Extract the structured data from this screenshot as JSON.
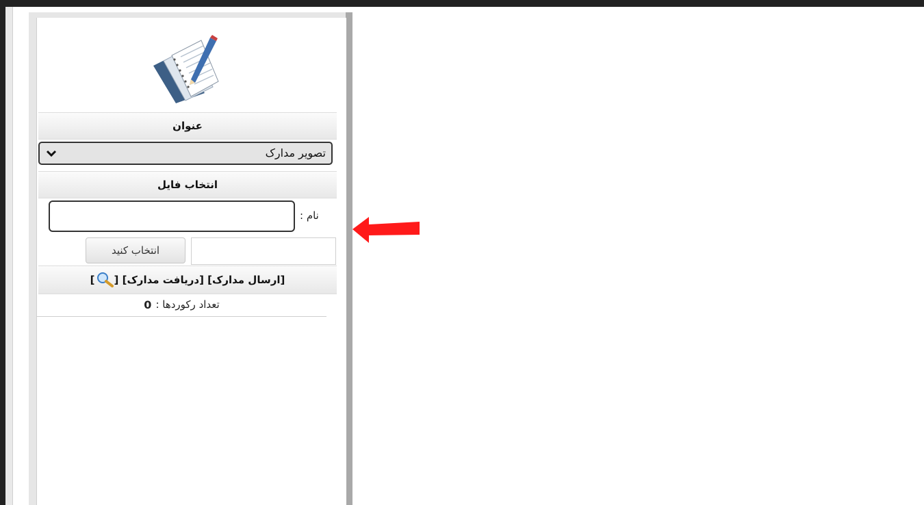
{
  "form": {
    "title_header": "عنوان",
    "document_select": {
      "selected": "تصویر مدارک"
    },
    "file_section_header": "انتخاب فایل",
    "name_label": "نام :",
    "name_value": "",
    "choose_button_label": "انتخاب کنید",
    "links": {
      "open_bracket": "[",
      "send_docs": "ارسال مدارک",
      "mid_bracket": "] [",
      "receive_docs": "دریافت مدارک",
      "search_open": "] [",
      "search_close": "]"
    },
    "record_count_label": "تعداد رکوردها :",
    "record_count_value": "0"
  },
  "icons": {
    "logo": "document-edit-icon",
    "dropdown": "chevron-down-icon",
    "search": "search-icon",
    "annotation": "red-arrow-left-icon"
  },
  "colors": {
    "annotation_arrow": "#ff1a1a",
    "panel_border": "#a9a9a9"
  }
}
